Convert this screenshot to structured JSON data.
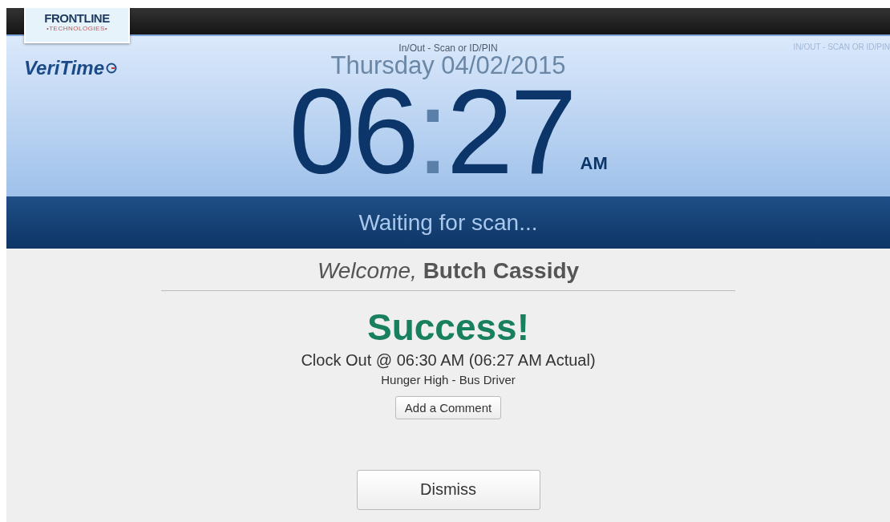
{
  "brand": {
    "company": "FRONTLINE",
    "company_sub": "•TECHNOLOGIES•",
    "product": "VeriTime"
  },
  "header": {
    "mode": "In/Out - Scan or ID/PIN",
    "mode_corner": "IN/OUT - SCAN OR ID/PIN",
    "date": "Thursday 04/02/2015",
    "hours": "06",
    "separator": ":",
    "minutes": "27",
    "meridiem": "AM"
  },
  "status": "Waiting for scan...",
  "welcome": "*Welcome,* **Butch Cassidy**",
  "result": {
    "title": "Success!",
    "detail": "Clock Out @ 06:30 AM (06:27 AM Actual)",
    "job": "Hunger High - Bus Driver",
    "comment_button": "Add a Comment"
  },
  "dismiss_button": "Dismiss"
}
